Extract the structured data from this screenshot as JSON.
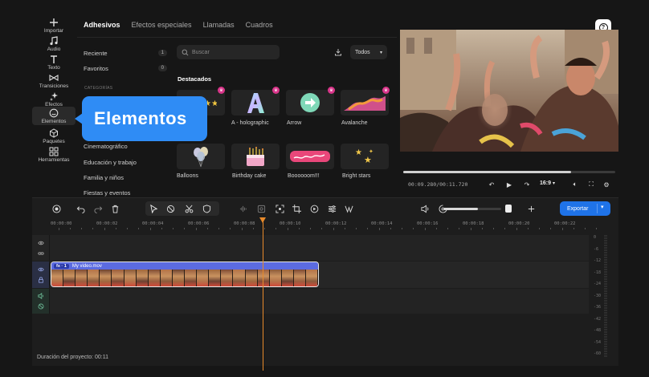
{
  "rail": [
    {
      "name": "rail-importar",
      "icon": "plus-icon",
      "label": "Importar"
    },
    {
      "name": "rail-audio",
      "icon": "music-note-icon",
      "label": "Audio"
    },
    {
      "name": "rail-texto",
      "icon": "text-t-icon",
      "label": "Texto"
    },
    {
      "name": "rail-transiciones",
      "icon": "bowtie-icon",
      "label": "Transiciones"
    },
    {
      "name": "rail-efectos",
      "icon": "sparkle-icon",
      "label": "Efectos"
    },
    {
      "name": "rail-elementos",
      "icon": "smiley-icon",
      "label": "Elementos"
    },
    {
      "name": "rail-paquetes",
      "icon": "box-icon",
      "label": "Paquetes"
    },
    {
      "name": "rail-herramientas",
      "icon": "grid-icon",
      "label": "Herramientas"
    }
  ],
  "tabs": [
    "Adhesivos",
    "Efectos especiales",
    "Llamadas",
    "Cuadros"
  ],
  "categories": {
    "reciente": {
      "label": "Reciente",
      "count": "1"
    },
    "favoritos": {
      "label": "Favoritos",
      "count": "0"
    },
    "title": "CATEGORÍAS",
    "list": [
      "Cinematográfico",
      "Educación y trabajo",
      "Familia y niños",
      "Fiestas y eventos"
    ]
  },
  "search": {
    "placeholder": "Buscar"
  },
  "filter": {
    "value": "Todos"
  },
  "featured_title": "Destacados",
  "stickers": [
    {
      "label": "",
      "crown": true
    },
    {
      "label": "A - holographic",
      "crown": true
    },
    {
      "label": "Arrow",
      "crown": true
    },
    {
      "label": "Avalanche",
      "crown": true
    },
    {
      "label": "Balloons",
      "crown": false
    },
    {
      "label": "Birthday cake",
      "crown": false
    },
    {
      "label": "Boooooom!!!",
      "crown": false
    },
    {
      "label": "Bright stars",
      "crown": false
    }
  ],
  "callout": "Elementos",
  "preview": {
    "timecode": "00:09.280/00:11.720",
    "aspect": "16:9",
    "progress": 0.79
  },
  "timeline": {
    "export_label": "Exportar",
    "ruler": [
      "00:00:00",
      "00:00:02",
      "00:00:04",
      "00:00:06",
      "00:00:08",
      "00:00:10",
      "00:00:12",
      "00:00:14",
      "00:00:16",
      "00:00:18",
      "00:00:20",
      "00:00:22"
    ],
    "clip": {
      "fx": "fx · 1",
      "name": "My video.mov"
    },
    "meter_labels": [
      "0",
      "-6",
      "-12",
      "-18",
      "-24",
      "-30",
      "-36",
      "-42",
      "-48",
      "-54",
      "-60"
    ],
    "zoom": 0.6,
    "duration_label": "Duración del proyecto:",
    "duration_value": "00:11"
  },
  "colors": {
    "accent": "#2f8cf5",
    "export": "#1f73e8",
    "playhead": "#e88a2a",
    "crown": "#d9358a"
  }
}
